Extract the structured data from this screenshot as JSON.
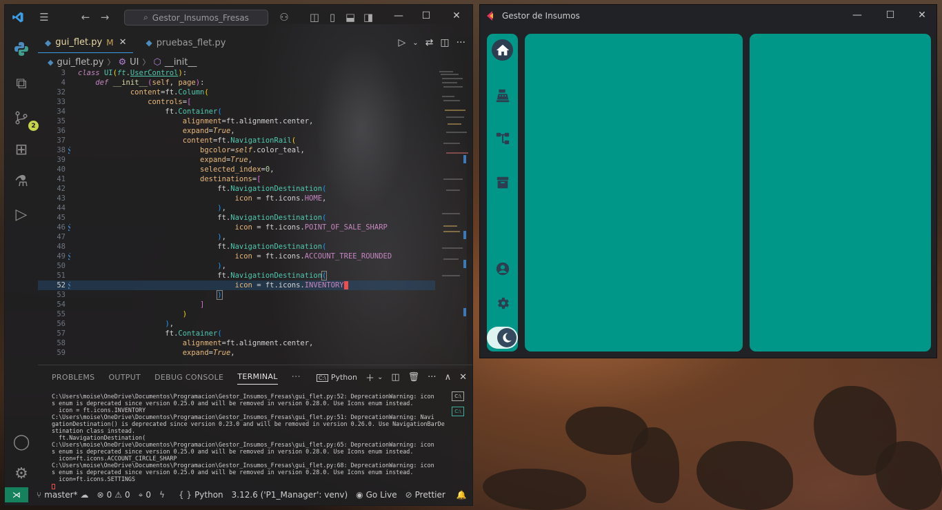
{
  "vscode": {
    "search_placeholder": "Gestor_Insumos_Fresas",
    "tabs": [
      {
        "label": "gui_flet.py",
        "modified": "M",
        "active": true
      },
      {
        "label": "pruebas_flet.py",
        "active": false
      }
    ],
    "breadcrumbs": {
      "file": "gui_flet.py",
      "class": "UI",
      "method": "__init__"
    },
    "scm_badge": "2",
    "current_line": "52",
    "panel_tabs": [
      "PROBLEMS",
      "OUTPUT",
      "DEBUG CONSOLE",
      "TERMINAL"
    ],
    "terminal_profile": "Python",
    "terminal_lines": [
      "C:\\Users\\moise\\OneDrive\\Documentos\\Programacion\\Gestor_Insumos_Fresas\\gui_flet.py:52: DeprecationWarning: icon",
      "s enum is deprecated since version 0.25.0 and will be removed in version 0.28.0. Use Icons enum instead.",
      "  icon = ft.icons.INVENTORY",
      "C:\\Users\\moise\\OneDrive\\Documentos\\Programacion\\Gestor_Insumos_Fresas\\gui_flet.py:51: DeprecationWarning: Navi",
      "gationDestination() is deprecated since version 0.23.0 and will be removed in version 0.26.0. Use NavigationBarDe",
      "stination class instead.",
      "  ft.NavigationDestination(",
      "C:\\Users\\moise\\OneDrive\\Documentos\\Programacion\\Gestor_Insumos_Fresas\\gui_flet.py:65: DeprecationWarning: icon",
      "s enum is deprecated since version 0.25.0 and will be removed in version 0.28.0. Use Icons enum instead.",
      "  icon=ft.icons.ACCOUNT_CIRCLE_SHARP",
      "C:\\Users\\moise\\OneDrive\\Documentos\\Programacion\\Gestor_Insumos_Fresas\\gui_flet.py:68: DeprecationWarning: icon",
      "s enum is deprecated since version 0.25.0 and will be removed in version 0.28.0. Use Icons enum instead.",
      "  icon=ft.icons.SETTINGS"
    ],
    "status": {
      "branch": "master*",
      "errors": "0",
      "warnings": "0",
      "ports": "0",
      "language": "Python",
      "interpreter": "3.12.6 ('P1_Manager': venv)",
      "golive": "Go Live",
      "prettier": "Prettier"
    }
  },
  "flet": {
    "title": "Gestor de Insumos",
    "accent": "#009688",
    "rail_icons": [
      "home-icon",
      "point-of-sale-icon",
      "account-tree-icon",
      "inventory-icon",
      "account-circle-icon",
      "settings-icon"
    ]
  }
}
